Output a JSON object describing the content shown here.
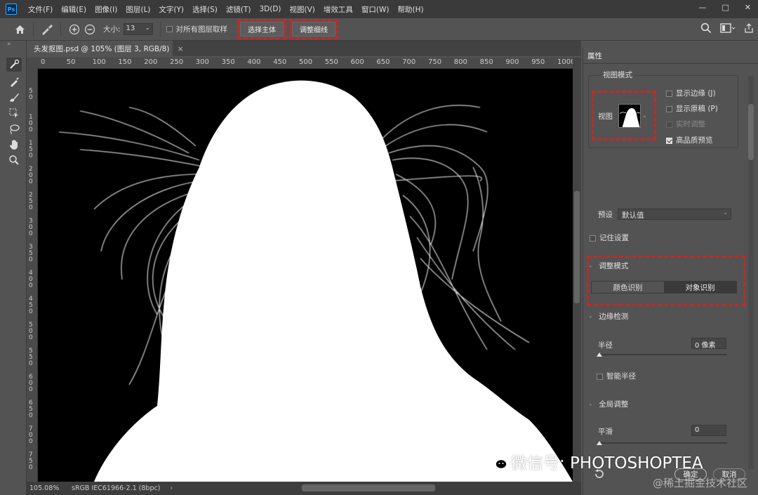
{
  "app": {
    "logo": "Ps"
  },
  "menu": [
    "文件(F)",
    "编辑(E)",
    "图像(I)",
    "图层(L)",
    "文字(Y)",
    "选择(S)",
    "滤镜(T)",
    "3D(D)",
    "视图(V)",
    "增效工具",
    "窗口(W)",
    "帮助(H)"
  ],
  "options": {
    "size_label": "大小:",
    "size_value": "13",
    "sample_all_layers": "对所有图层取样",
    "select_subject": "选择主体",
    "refine_hair": "调整细线"
  },
  "document": {
    "tab_title": "头发抠图.psd @ 105% (图层 3, RGB/8)",
    "close": "×",
    "ruler_ticks": [
      "0",
      "50",
      "100",
      "150",
      "200",
      "250",
      "300",
      "350",
      "400",
      "450",
      "500",
      "550",
      "600",
      "650",
      "700",
      "750",
      "800",
      "850",
      "900",
      "950",
      "1000"
    ],
    "ruler_v": [
      "5\n0",
      "1\n0\n0",
      "1\n5\n0",
      "2\n0\n0",
      "2\n5\n0",
      "3\n0\n0",
      "3\n5\n0",
      "4\n0\n0",
      "4\n5\n0",
      "5\n0\n0",
      "5\n5\n0",
      "6\n0\n0",
      "6\n5\n0",
      "7\n0\n0",
      "7\n5\n0"
    ]
  },
  "status": {
    "zoom": "105.08%",
    "profile": "sRGB IEC61966-2.1 (8bpc)"
  },
  "panel": {
    "tab": "属性",
    "view_mode": {
      "title": "视图模式",
      "view_label": "视图",
      "show_edge": "显示边缘 (J)",
      "show_original": "显示原稿 (P)",
      "realtime": "实时调整",
      "hq_preview": "高品质预览"
    },
    "preset_label": "预设",
    "preset_value": "默认值",
    "remember": "记住设置",
    "refine_mode": {
      "title": "调整模式",
      "color_aware": "颜色识别",
      "object_aware": "对象识别"
    },
    "edge_detection": {
      "title": "边缘检测",
      "radius_label": "半径",
      "radius_value": "0 像素",
      "smart_radius": "智能半径"
    },
    "global": {
      "title": "全局调整",
      "smooth_label": "平滑",
      "smooth_value": "0"
    },
    "ok": "确定",
    "cancel": "取消"
  },
  "overlay": {
    "watermark": "微信号: PHOTOSHOPTEA",
    "credit": "@稀土掘金技术社区"
  }
}
